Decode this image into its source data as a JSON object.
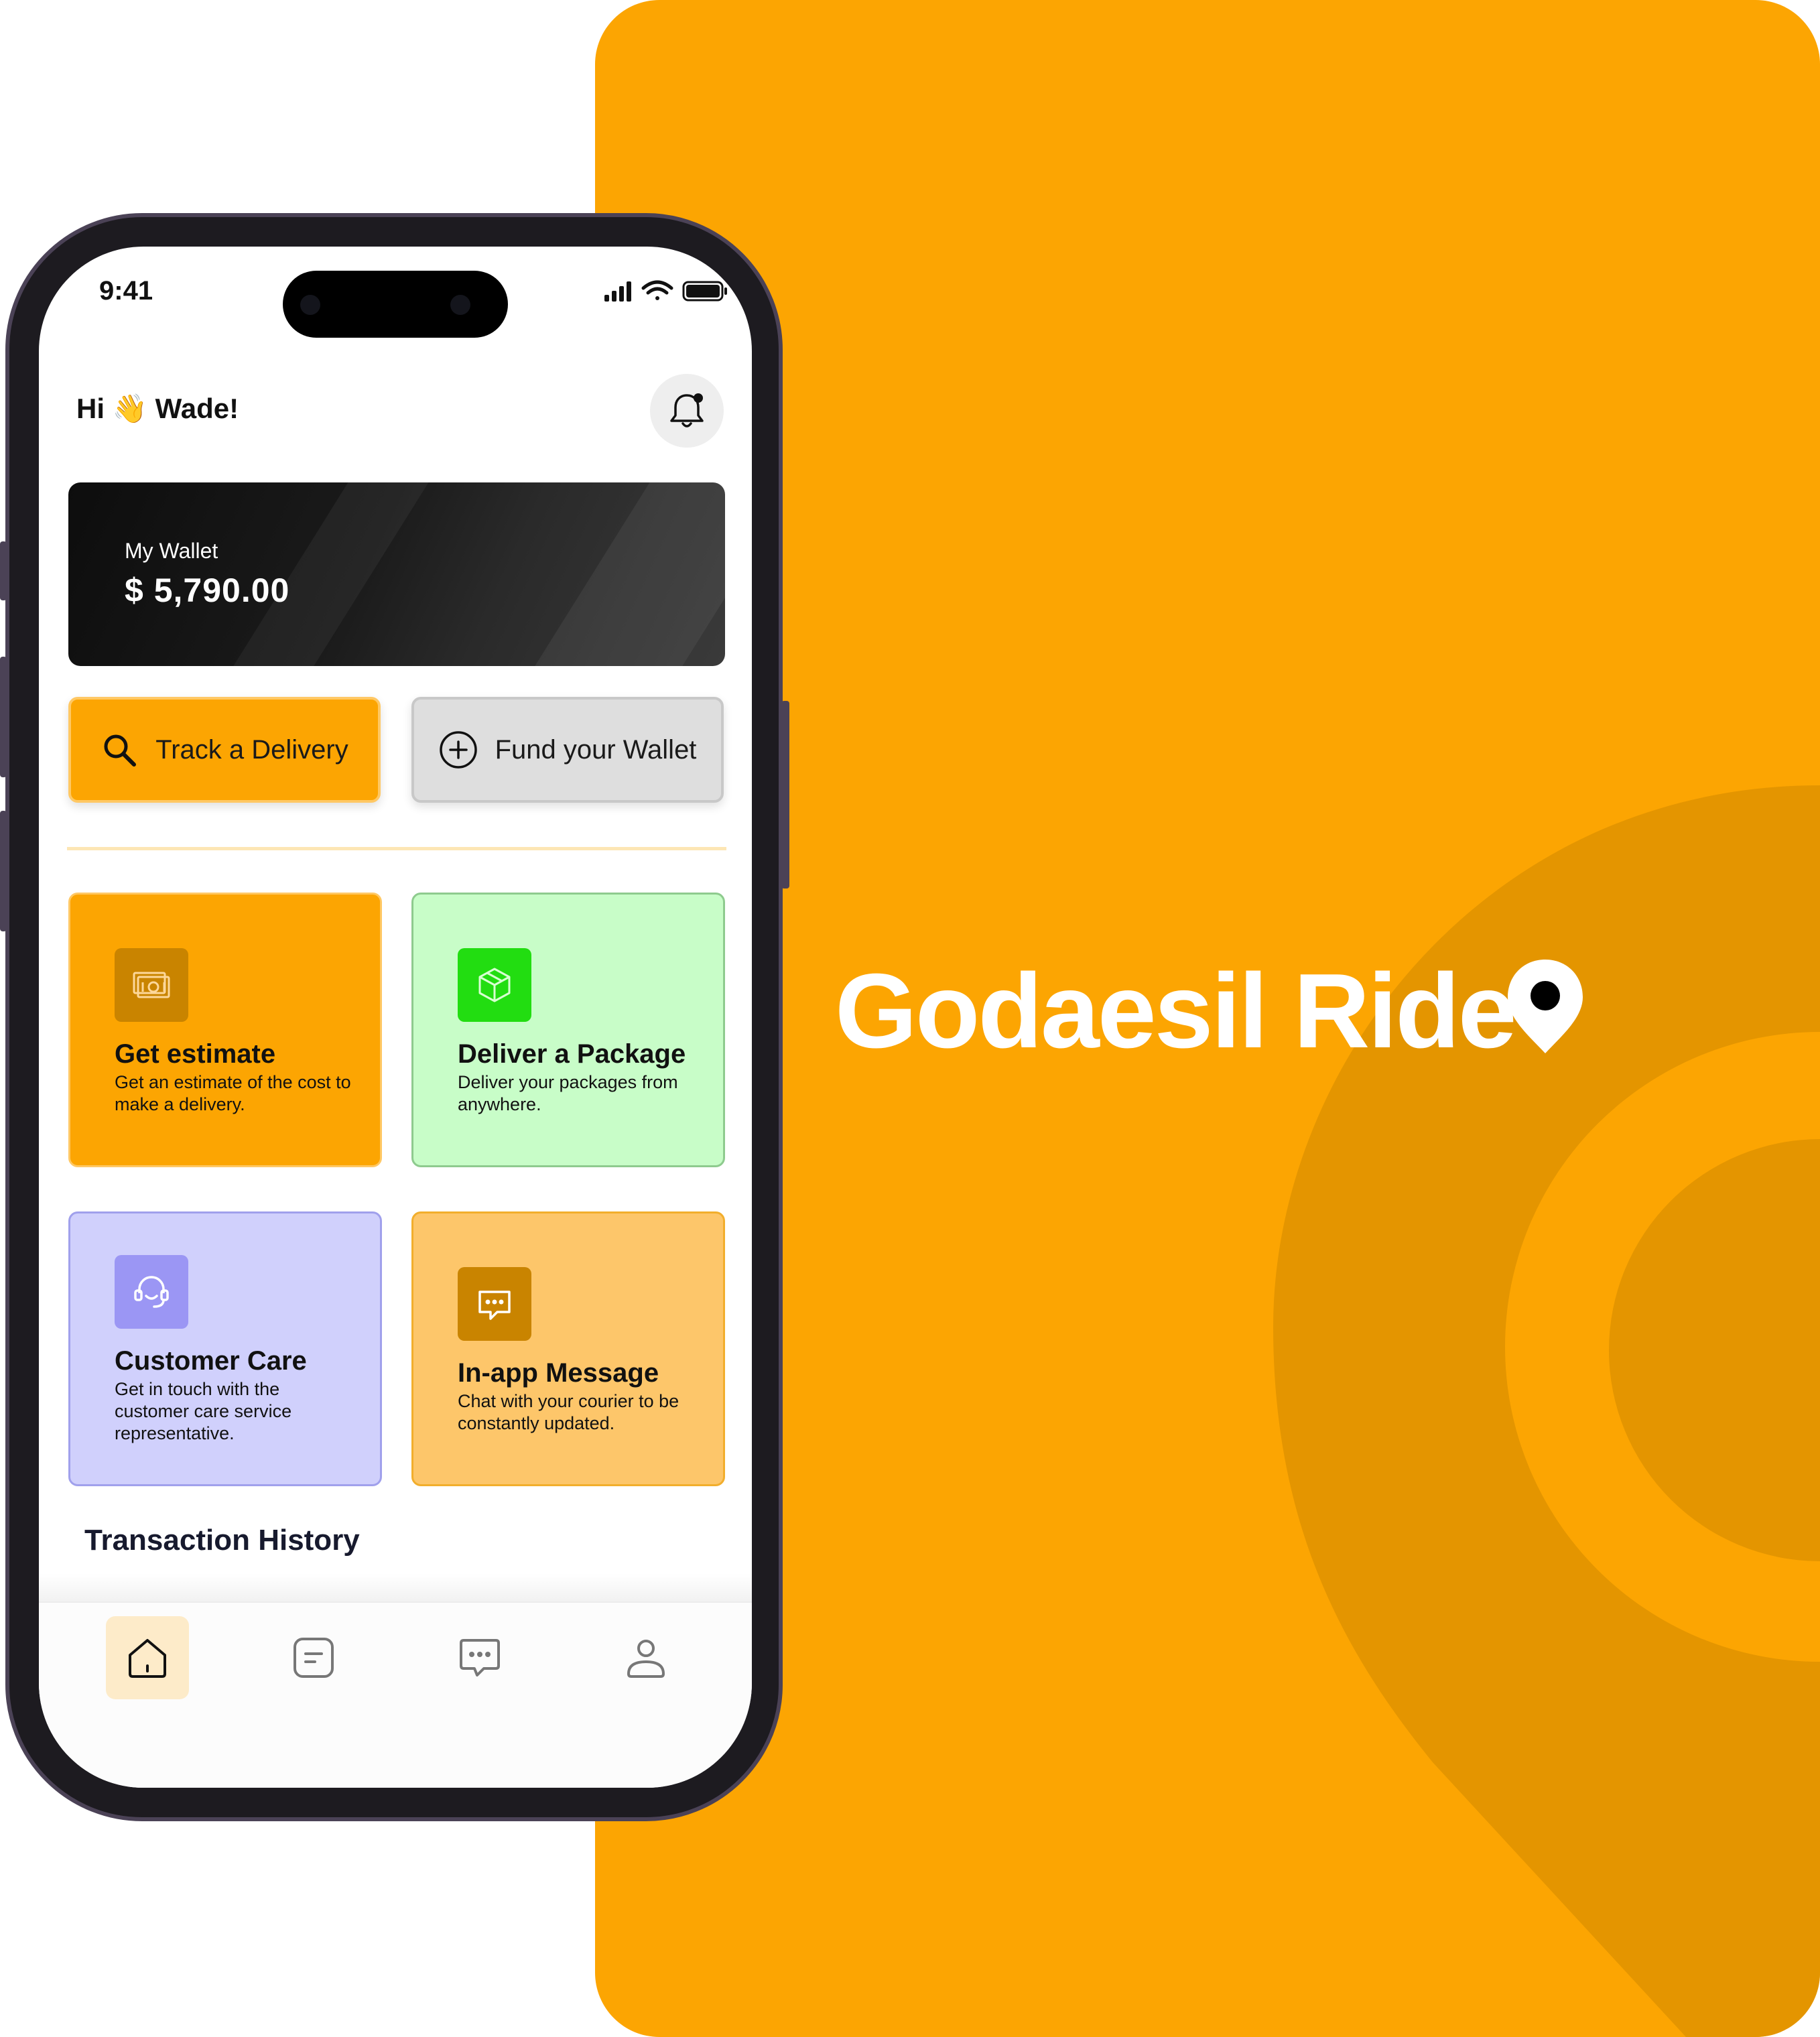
{
  "colors": {
    "brand_orange": "#FCA502",
    "brand_orange_dark": "#E49500",
    "wallet_card": "#111111",
    "deliver_tile": "#C8FDC8",
    "deliver_icon": "#22DD11",
    "care_tile": "#D0D0FC",
    "care_icon": "#9B96F4",
    "message_tile": "#FDC66A",
    "message_icon": "#C98400",
    "nav_active": "#FDEBC9"
  },
  "brand": {
    "name": "Godaesil Ride"
  },
  "status_bar": {
    "time": "9:41",
    "icons": [
      "signal-icon",
      "wifi-icon",
      "battery-icon"
    ]
  },
  "header": {
    "greeting": "Hi 👋 Wade!",
    "bell_icon": "bell-icon"
  },
  "wallet": {
    "label": "My Wallet",
    "balance": "$ 5,790.00"
  },
  "actions": {
    "track": {
      "label": "Track a Delivery",
      "icon": "search-icon"
    },
    "fund": {
      "label": "Fund your Wallet",
      "icon": "plus-circle-icon"
    }
  },
  "services": [
    {
      "title": "Get estimate",
      "description": "Get an estimate of the cost to make a delivery.",
      "icon": "money-icon"
    },
    {
      "title": "Deliver a Package",
      "description": "Deliver your packages from anywhere.",
      "icon": "package-icon"
    },
    {
      "title": "Customer Care",
      "description": "Get in touch with the customer care service representative.",
      "icon": "headset-icon"
    },
    {
      "title": "In-app Message",
      "description": "Chat with your courier to be constantly updated.",
      "icon": "chat-icon"
    }
  ],
  "transactions": {
    "title": "Transaction History"
  },
  "tabbar": {
    "tabs": [
      {
        "icon": "home-icon",
        "active": true
      },
      {
        "icon": "orders-icon",
        "active": false
      },
      {
        "icon": "messages-icon",
        "active": false
      },
      {
        "icon": "profile-icon",
        "active": false
      }
    ]
  }
}
